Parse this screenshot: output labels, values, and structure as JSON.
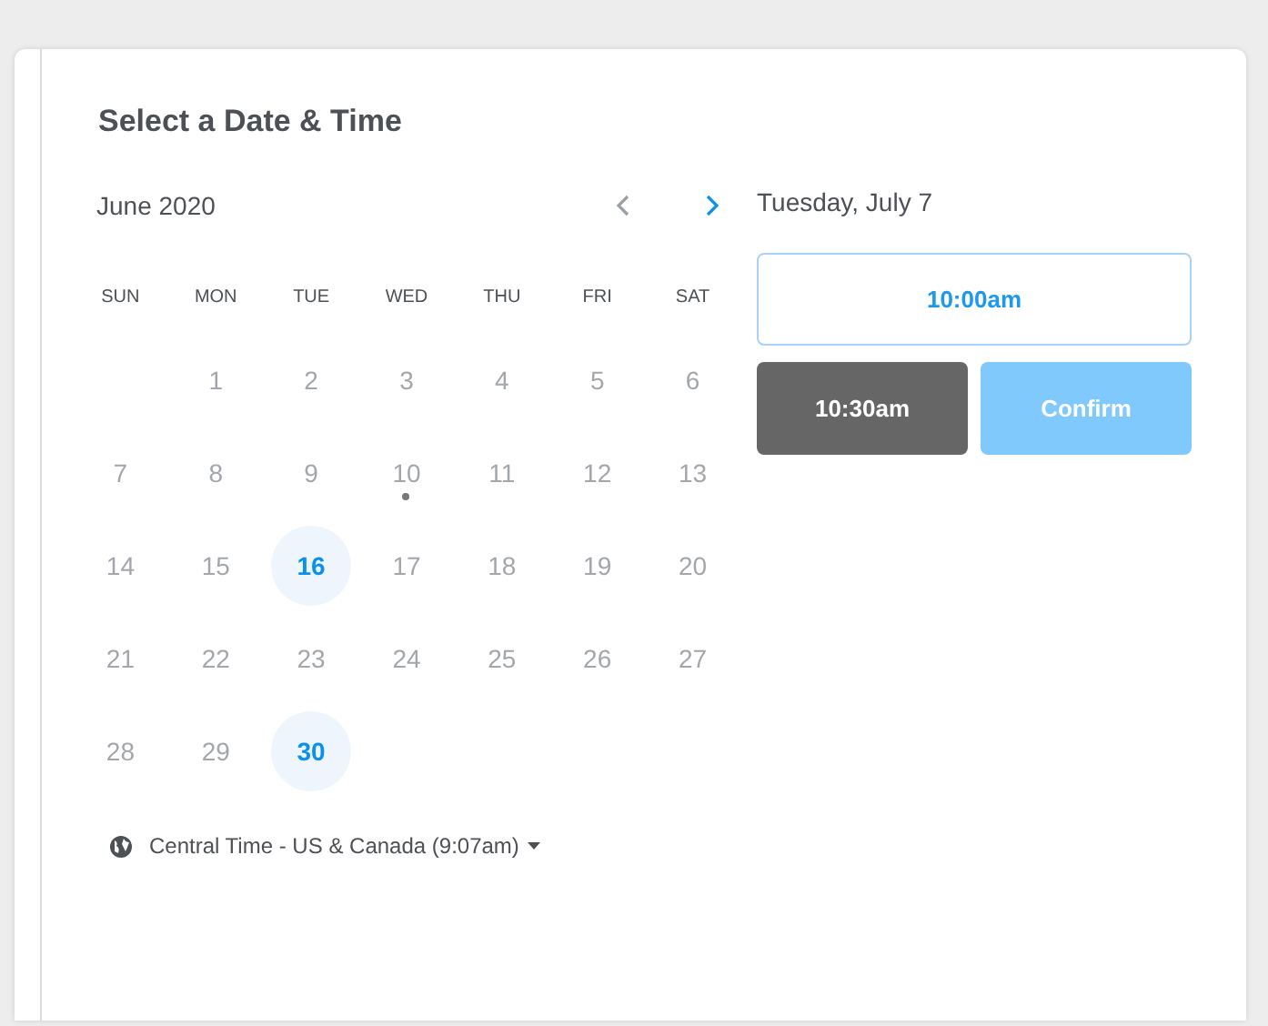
{
  "title": "Select a Date & Time",
  "calendar": {
    "month": "June 2020",
    "prev_enabled": false,
    "next_enabled": true,
    "weekdays": [
      "SUN",
      "MON",
      "TUE",
      "WED",
      "THU",
      "FRI",
      "SAT"
    ],
    "weeks": [
      {
        "kind": "partial",
        "days": [
          {
            "day": "1",
            "available": false,
            "today": false
          },
          {
            "day": "2",
            "available": false,
            "today": false
          },
          {
            "day": "3",
            "available": false,
            "today": false
          },
          {
            "day": "4",
            "available": false,
            "today": false
          },
          {
            "day": "5",
            "available": false,
            "today": false
          },
          {
            "day": "6",
            "available": false,
            "today": false
          }
        ]
      },
      {
        "kind": "full",
        "days": [
          {
            "day": "7",
            "available": false,
            "today": false
          },
          {
            "day": "8",
            "available": false,
            "today": false
          },
          {
            "day": "9",
            "available": false,
            "today": false
          },
          {
            "day": "10",
            "available": false,
            "today": true
          },
          {
            "day": "11",
            "available": false,
            "today": false
          },
          {
            "day": "12",
            "available": false,
            "today": false
          },
          {
            "day": "13",
            "available": false,
            "today": false
          }
        ]
      },
      {
        "kind": "full",
        "days": [
          {
            "day": "14",
            "available": false,
            "today": false
          },
          {
            "day": "15",
            "available": false,
            "today": false
          },
          {
            "day": "16",
            "available": true,
            "today": false
          },
          {
            "day": "17",
            "available": false,
            "today": false
          },
          {
            "day": "18",
            "available": false,
            "today": false
          },
          {
            "day": "19",
            "available": false,
            "today": false
          },
          {
            "day": "20",
            "available": false,
            "today": false
          }
        ]
      },
      {
        "kind": "full",
        "days": [
          {
            "day": "21",
            "available": false,
            "today": false
          },
          {
            "day": "22",
            "available": false,
            "today": false
          },
          {
            "day": "23",
            "available": false,
            "today": false
          },
          {
            "day": "24",
            "available": false,
            "today": false
          },
          {
            "day": "25",
            "available": false,
            "today": false
          },
          {
            "day": "26",
            "available": false,
            "today": false
          },
          {
            "day": "27",
            "available": false,
            "today": false
          }
        ]
      },
      {
        "kind": "full",
        "days": [
          {
            "day": "28",
            "available": false,
            "today": false
          },
          {
            "day": "29",
            "available": false,
            "today": false
          },
          {
            "day": "30",
            "available": true,
            "today": false
          }
        ]
      }
    ]
  },
  "timezone": "Central Time - US & Canada (9:07am)",
  "selected_date": "Tuesday, July 7",
  "times": [
    {
      "label": "10:00am",
      "selected": false
    },
    {
      "label": "10:30am",
      "selected": true
    }
  ],
  "confirm_label": "Confirm"
}
